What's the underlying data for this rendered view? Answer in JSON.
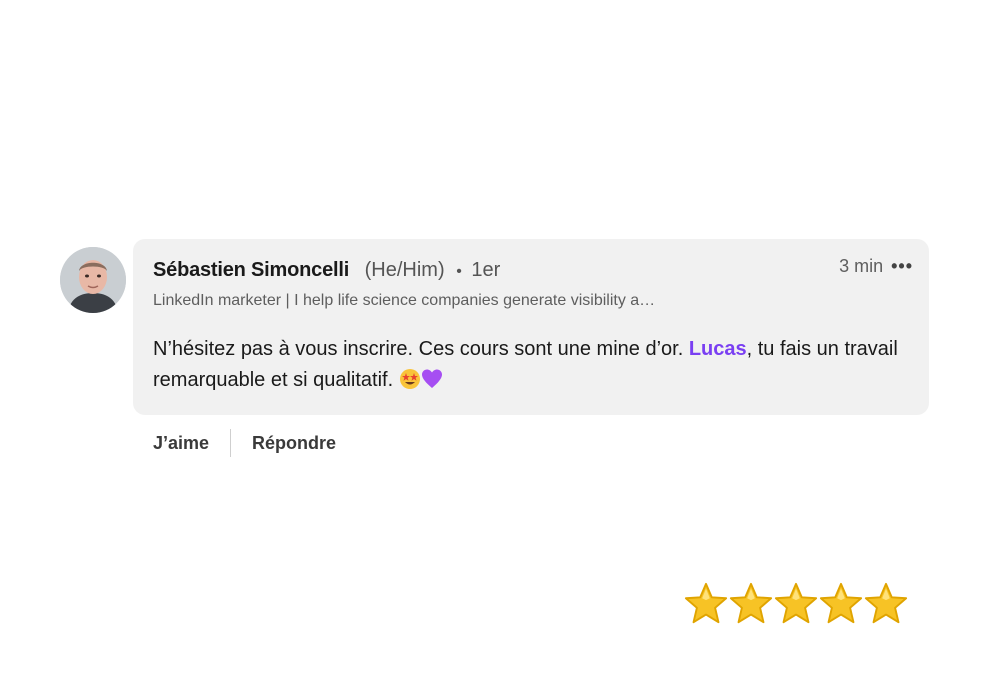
{
  "comment": {
    "author_name": "Sébastien Simoncelli",
    "pronouns": "(He/Him)",
    "separator": "•",
    "connection_degree": "1er",
    "headline": "LinkedIn marketer | I help life science companies generate visibility a…",
    "timestamp": "3 min",
    "more_label": "•••",
    "text_before_mention": "N’hésitez pas à vous inscrire. Ces cours sont une mine d’or. ",
    "mention": "Lucas",
    "text_after_mention": ", tu fais un travail remarquable et si qualitatif. ",
    "emojis": [
      "star-struck-emoji",
      "purple-heart-emoji"
    ]
  },
  "actions": {
    "like_label": "J’aime",
    "reply_label": "Répondre"
  },
  "rating": {
    "stars": 5,
    "max": 5,
    "star_color": "#f7c325"
  },
  "colors": {
    "bubble_bg": "#f1f1f1",
    "mention": "#7a3ff2",
    "text": "#1a1a1a",
    "secondary_text": "#5e5e5e"
  }
}
